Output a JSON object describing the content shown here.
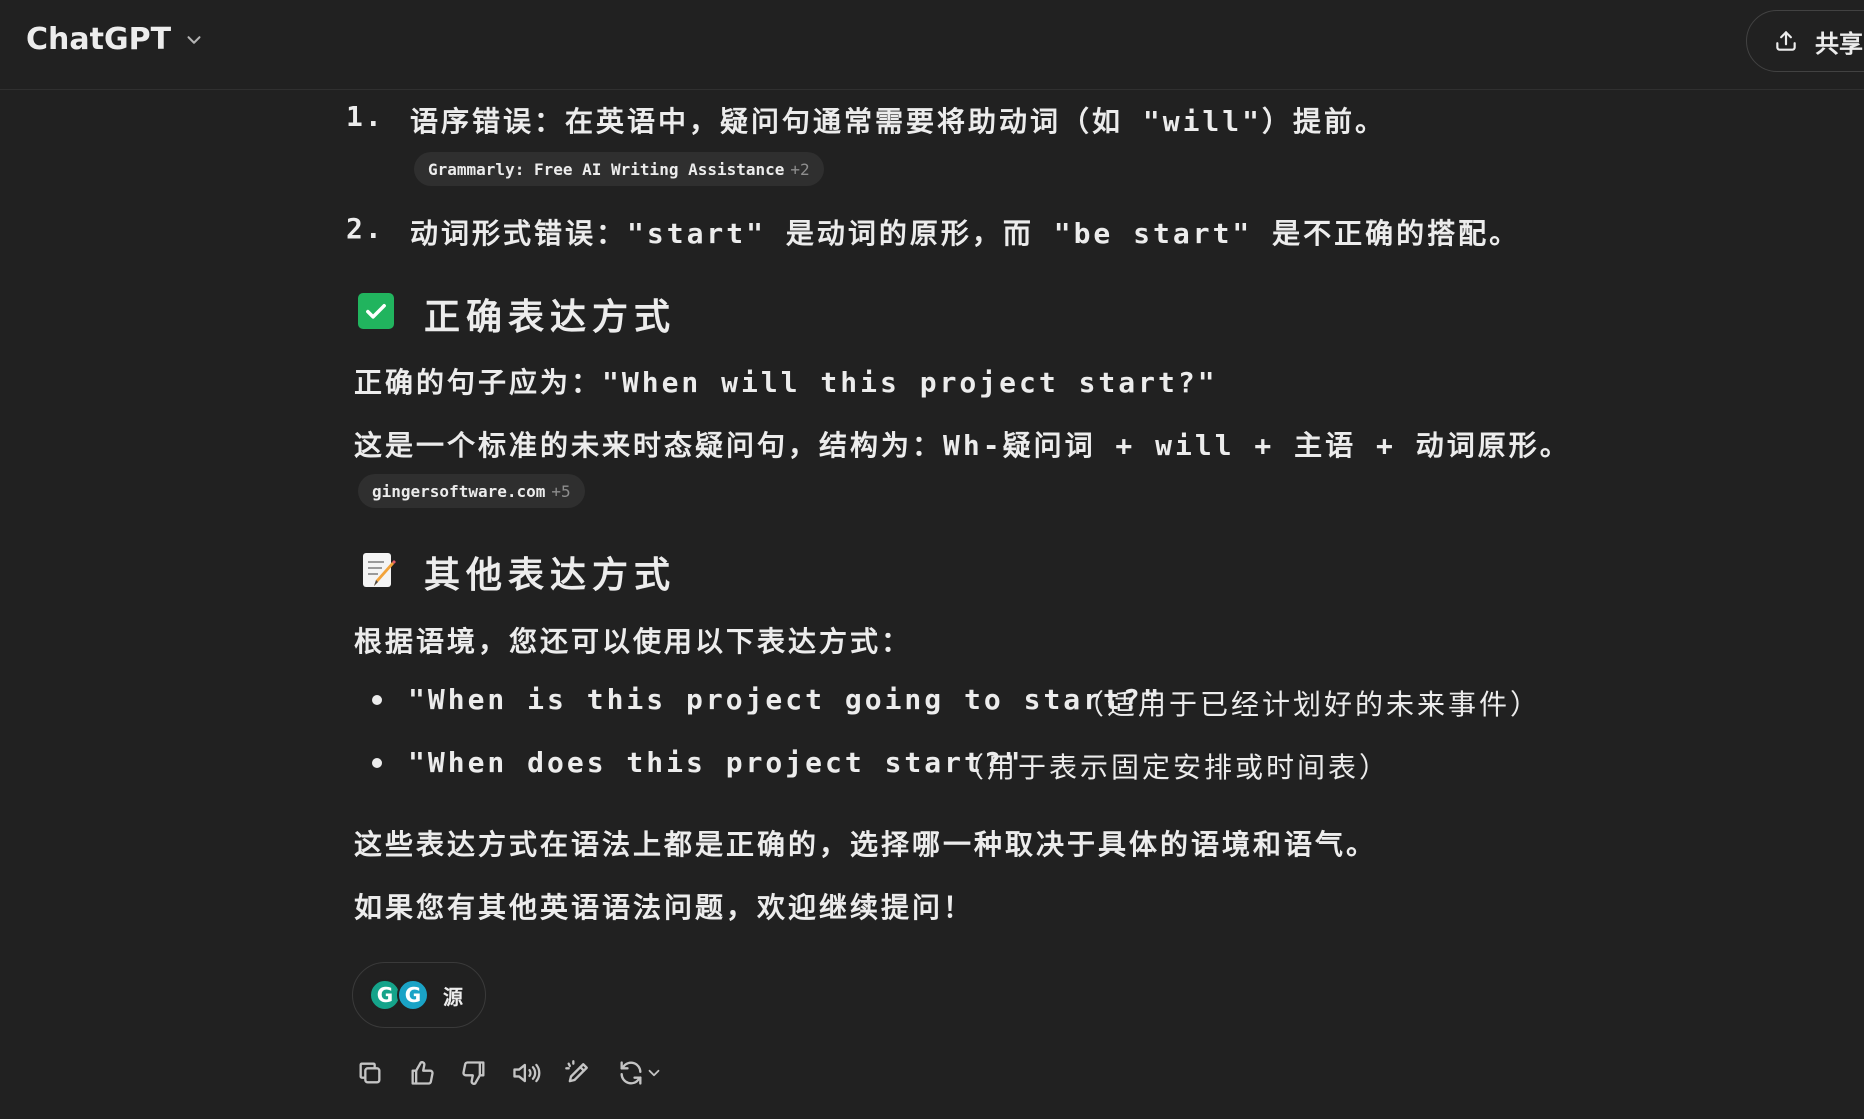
{
  "header": {
    "title": "ChatGPT",
    "share_label": "共享"
  },
  "errors": [
    {
      "num": "1.",
      "text": "语序错误：在英语中，疑问句通常需要将助动词（如 \"will\"）提前。"
    },
    {
      "num": "2.",
      "text": "动词形式错误：\"start\" 是动词的原形，而 \"be start\" 是不正确的搭配。"
    }
  ],
  "citation1": {
    "label": "Grammarly: Free AI Writing Assistance",
    "more": "+2"
  },
  "correct": {
    "heading": "正确表达方式",
    "sentence": "正确的句子应为：\"When will this project start?\"",
    "structure": "这是一个标准的未来时态疑问句，结构为：Wh-疑问词 + will + 主语 + 动词原形。"
  },
  "citation2": {
    "label": "gingersoftware.com",
    "more": "+5"
  },
  "other": {
    "heading": "其他表达方式",
    "intro": "根据语境，您还可以使用以下表达方式：",
    "items": [
      {
        "quote": "\"When is this project going to start?\"",
        "note": "（适用于已经计划好的未来事件）"
      },
      {
        "quote": "\"When does this project start?\"",
        "note": "（用于表示固定安排或时间表）"
      }
    ],
    "summary": "这些表达方式在语法上都是正确的，选择哪一种取决于具体的语境和语气。",
    "closing": "如果您有其他英语语法问题，欢迎继续提问！"
  },
  "sources": {
    "label": "源",
    "icons": [
      {
        "name": "grammarly-icon",
        "letter": "G",
        "color": "#15a38a"
      },
      {
        "name": "ginger-icon",
        "letter": "G",
        "color": "#1aa3c6"
      }
    ]
  },
  "actions": [
    "copy-icon",
    "thumbs-up-icon",
    "thumbs-down-icon",
    "read-aloud-icon",
    "edit-icon",
    "regenerate-icon"
  ],
  "colors": {
    "background": "#212121",
    "text": "#ececec",
    "check": "#21b45e",
    "chip": "#2f2f2f"
  }
}
